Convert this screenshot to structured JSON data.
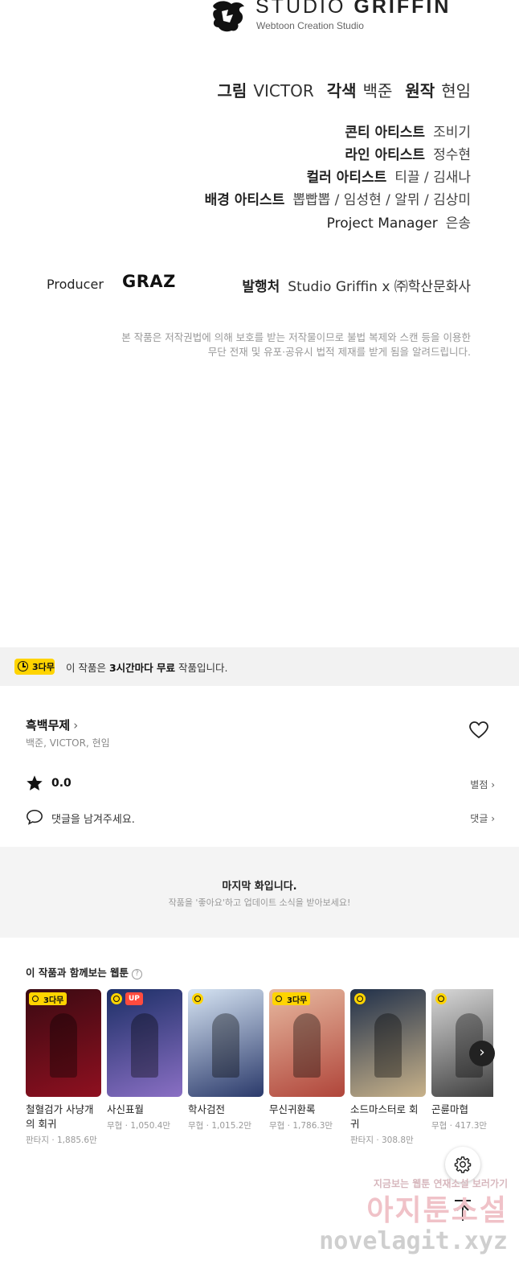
{
  "credits": {
    "studio_title_light": "STUDIO",
    "studio_title_bold": "GRIFFIN",
    "studio_subtitle": "Webtoon Creation Studio",
    "main_row": [
      {
        "role": "그림",
        "name": "VICTOR"
      },
      {
        "role": "각색",
        "name": "백준"
      },
      {
        "role": "원작",
        "name": "현임"
      }
    ],
    "rows": [
      {
        "role": "콘티 아티스트",
        "name": "조비기"
      },
      {
        "role": "라인 아티스트",
        "name": "정수현"
      },
      {
        "role": "컬러 아티스트",
        "name": "티끌 / 김새나"
      },
      {
        "role": "배경 아티스트",
        "name": "뽑빱뽑 / 임성현 / 알뮈 / 김상미"
      },
      {
        "role": "Project Manager",
        "name": "은송"
      }
    ],
    "producer_label": "Producer",
    "producer_name": "GRAZ",
    "publisher_label": "발행처",
    "publisher_name": "Studio Griffin x ㈜학산문화사",
    "copyright_line1": "본 작품은 저작권법에 의해 보호를 받는 저작물이므로 불법 복제와 스캔 등을 이용한",
    "copyright_line2": "무단 전재 및 유포·공유시 법적 제재를 받게 됨을 알려드립니다."
  },
  "free_bar": {
    "badge": "3다무",
    "text_prefix": "이 작품은 ",
    "text_bold": "3시간마다 무료",
    "text_suffix": " 작품입니다."
  },
  "info": {
    "title": "흑백무제",
    "title_chevron": "›",
    "authors": "백준, VICTOR, 현임",
    "rating": "0.0",
    "rating_link": "별점 ›",
    "comment_placeholder": "댓글을 남겨주세요.",
    "comment_link": "댓글 ›"
  },
  "last_episode": {
    "title": "마지막 화입니다.",
    "subtitle": "작품을 '좋아요'하고 업데이트 소식을 받아보세요!"
  },
  "recommendations": {
    "title": "이 작품과 함께보는 웹툰",
    "help": "?",
    "next": "›",
    "items": [
      {
        "title": "철혈검가 사냥개의 회귀",
        "meta": "판타지 · 1,885.6만",
        "badge": "3다무",
        "colors": [
          "#3a0a12",
          "#8f1020"
        ]
      },
      {
        "title": "사신표월",
        "meta": "무협 · 1,050.4만",
        "badge": "UP",
        "colors": [
          "#1c2f66",
          "#8a6fc4"
        ]
      },
      {
        "title": "학사검전",
        "meta": "무협 · 1,015.2만",
        "badge": "",
        "colors": [
          "#d6e4f3",
          "#2b3a6b"
        ]
      },
      {
        "title": "무신귀환록",
        "meta": "무협 · 1,786.3만",
        "badge": "3다무",
        "colors": [
          "#e7b9a0",
          "#b0453a"
        ]
      },
      {
        "title": "소드마스터로 회귀",
        "meta": "판타지 · 308.8만",
        "badge": "",
        "colors": [
          "#20304a",
          "#c8b28a"
        ]
      },
      {
        "title": "곤륜마협",
        "meta": "무협 · 417.3만",
        "badge": "",
        "colors": [
          "#d8d8d8",
          "#3a3a3a"
        ]
      }
    ]
  },
  "watermark": {
    "line1": "지금보는 웹툰 연재소설 보러가기",
    "line2": "아지툰소설",
    "line3": "novelagit.xyz"
  }
}
